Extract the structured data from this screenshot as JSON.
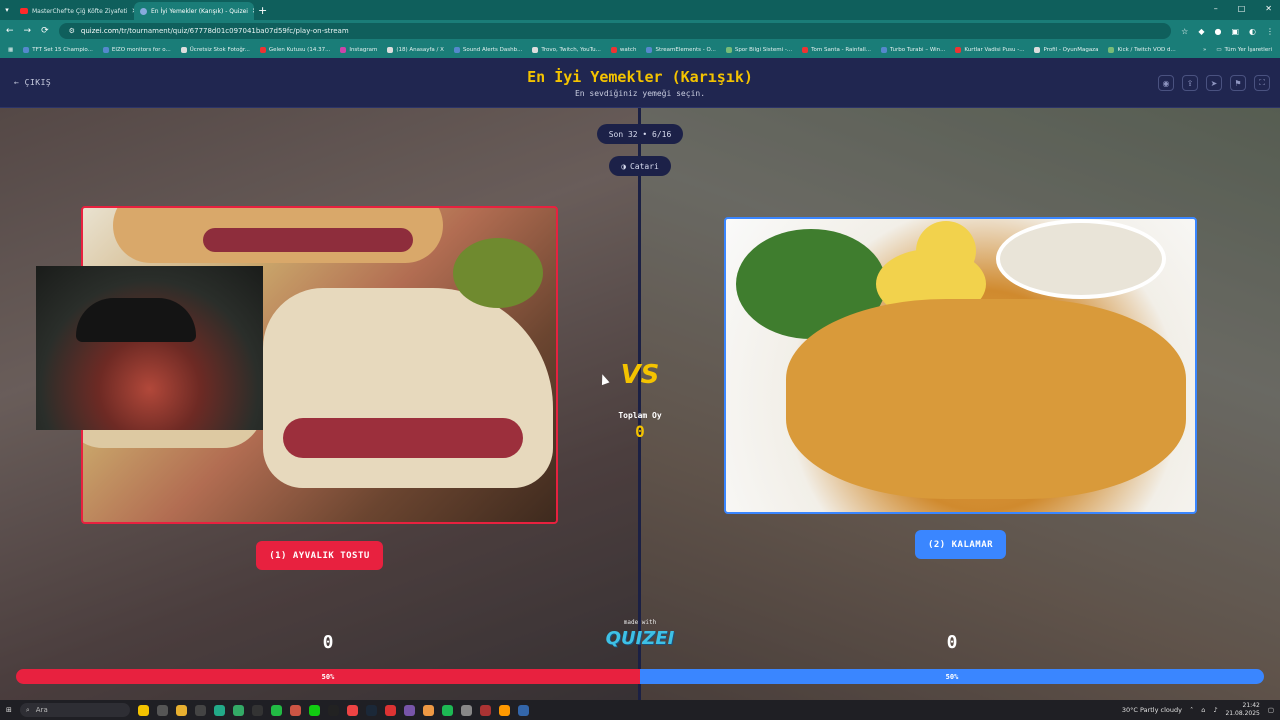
{
  "browser": {
    "tabs": [
      {
        "label": "MasterChef'te Çiğ Köfte Ziyafeti",
        "active": false
      },
      {
        "label": "En İyi Yemekler (Karışık) - Quizei",
        "active": true
      }
    ],
    "url_prefix": "quizei.com",
    "url_path": "/tr/tournament/quiz/67778d01c097041ba07d59fc/play-on-stream",
    "new_tab_symbol": "+",
    "window_controls": [
      "–",
      "□",
      "✕"
    ],
    "bookmarks": [
      "TFT Set 15 Champio...",
      "EIZO monitors for o...",
      "Ücretsiz Stok Fotoğr...",
      "Gelen Kutusu (14.37...",
      "Instagram",
      "(18) Anasayfa / X",
      "Sound Alerts Dashb...",
      "Trovo, Twitch, YouTu...",
      "watch",
      "StreamElements - O...",
      "Spor Bilgi Sistemi -...",
      "Tom Santa - Rainfall...",
      "Turbo Turabi – Win...",
      "Kurtlar Vadisi Pusu -...",
      "Profil - OyunMagaza",
      "Kick / Twitch VOD d..."
    ],
    "all_bookmarks": "Tüm Yer İşaretleri"
  },
  "quiz": {
    "exit_label": "ÇIKIŞ",
    "title": "En İyi Yemekler (Karışık)",
    "subtitle": "En sevdiğiniz yemeği seçin.",
    "round_label": "Son 32 • 6/16",
    "streamer_label": "Catari",
    "vs_label": "VS",
    "total_votes_label": "Toplam Oy",
    "total_votes": "0",
    "option_left": {
      "label": "(1) AYVALIK TOSTU",
      "votes": "0",
      "percent_label": "50%",
      "percent": 50
    },
    "option_right": {
      "label": "(2) KALAMAR",
      "votes": "0",
      "percent_label": "50%",
      "percent": 50
    },
    "made_with": "made with",
    "brand": "QUIZEI"
  },
  "colors": {
    "accent": "#f4c300",
    "left": "#e8213f",
    "right": "#3a86ff"
  },
  "taskbar": {
    "search_placeholder": "Ara",
    "weather": "30°C  Partly cloudy",
    "time": "21:42",
    "date": "21.08.2025"
  }
}
